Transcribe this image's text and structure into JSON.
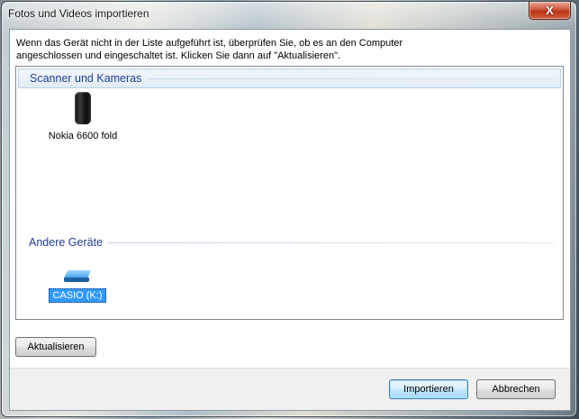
{
  "window": {
    "title": "Fotos und Videos importieren",
    "close_label": "X"
  },
  "instructions": "Wenn das Gerät nicht in der Liste aufgeführt ist, überprüfen Sie, ob es an den Computer\nangeschlossen und eingeschaltet ist. Klicken Sie dann auf \"Aktualisieren\".",
  "groups": [
    {
      "title": "Scanner und Kameras",
      "devices": [
        {
          "label": "Nokia 6600 fold",
          "icon": "phone-icon",
          "selected": false
        }
      ]
    },
    {
      "title": "Andere Geräte",
      "devices": [
        {
          "label": "CASIO (K:)",
          "icon": "drive-icon",
          "selected": true
        }
      ]
    }
  ],
  "buttons": {
    "refresh": "Aktualisieren",
    "import": "Importieren",
    "cancel": "Abbrechen"
  }
}
